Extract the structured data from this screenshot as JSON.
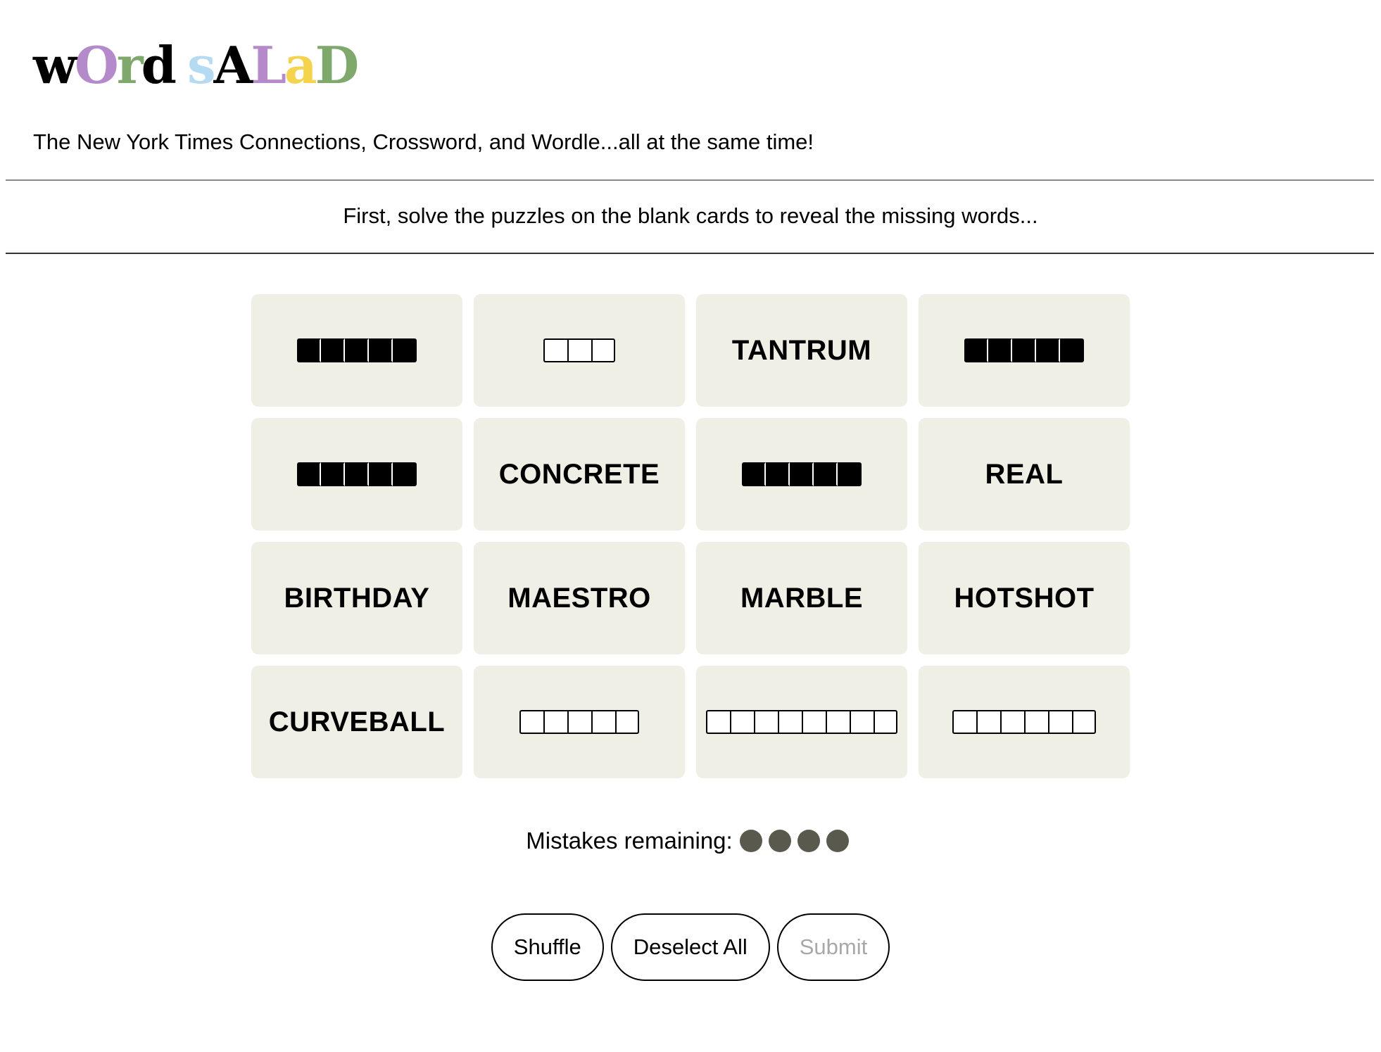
{
  "header": {
    "logo_letters": [
      {
        "char": "w",
        "color": "#000000"
      },
      {
        "char": "O",
        "color": "#b48acb"
      },
      {
        "char": "r",
        "color": "#7fa86c"
      },
      {
        "char": "d",
        "color": "#000000"
      },
      {
        "char": " ",
        "color": "#000000"
      },
      {
        "char": "s",
        "color": "#b5dbf2"
      },
      {
        "char": "A",
        "color": "#000000"
      },
      {
        "char": "L",
        "color": "#b48acb"
      },
      {
        "char": "a",
        "color": "#f5d34c"
      },
      {
        "char": "D",
        "color": "#7fa86c"
      }
    ],
    "tagline": "The New York Times Connections, Crossword, and Wordle...all at the same time!"
  },
  "instruction": "First, solve the puzzles on the blank cards to reveal the missing words...",
  "cards": [
    {
      "type": "filled",
      "count": 5
    },
    {
      "type": "blank",
      "count": 3
    },
    {
      "type": "word",
      "text": "TANTRUM"
    },
    {
      "type": "filled",
      "count": 5
    },
    {
      "type": "filled",
      "count": 5
    },
    {
      "type": "word",
      "text": "CONCRETE"
    },
    {
      "type": "filled",
      "count": 5
    },
    {
      "type": "word",
      "text": "REAL"
    },
    {
      "type": "word",
      "text": "BIRTHDAY"
    },
    {
      "type": "word",
      "text": "MAESTRO"
    },
    {
      "type": "word",
      "text": "MARBLE"
    },
    {
      "type": "word",
      "text": "HOTSHOT"
    },
    {
      "type": "word",
      "text": "CURVEBALL"
    },
    {
      "type": "blank",
      "count": 5
    },
    {
      "type": "blank",
      "count": 8
    },
    {
      "type": "blank",
      "count": 6
    }
  ],
  "mistakes": {
    "label": "Mistakes remaining:",
    "remaining": 4,
    "dot_color": "#5a594e"
  },
  "buttons": {
    "shuffle": "Shuffle",
    "deselect_all": "Deselect All",
    "submit": "Submit"
  }
}
